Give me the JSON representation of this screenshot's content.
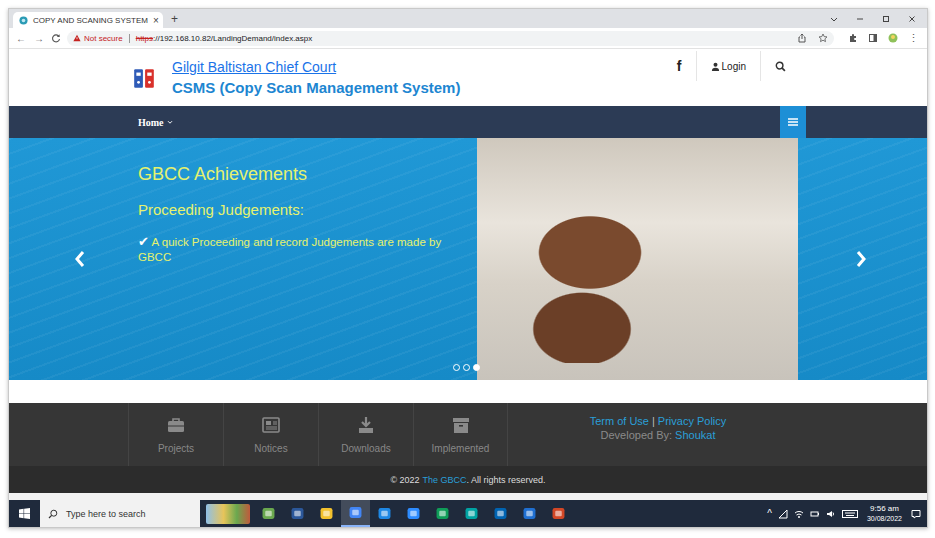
{
  "browser": {
    "tab": {
      "title": "COPY AND SCANING SYSTEM",
      "close": "×",
      "selected": true
    },
    "new_tab": "+",
    "back": "←",
    "forward": "→",
    "security": "Not secure",
    "url_scheme": "https",
    "url_rest": "://192.168.10.82/LandingDemand/index.aspx",
    "menu": "⋮"
  },
  "header": {
    "court": "Gilgit Baltistan Chief Court",
    "system": "CSMS (Copy Scan Management System)",
    "facebook": "f",
    "login": "Login"
  },
  "nav": {
    "items": [
      {
        "label": "Home",
        "selected": true
      }
    ]
  },
  "carousel": {
    "heading": "GBCC Achievements",
    "subheading": "Proceeding Judgements:",
    "check": "✔",
    "bullet": "A quick Proceeding and record Judgements are made by GBCC",
    "slides": [
      {
        "selected": false
      },
      {
        "selected": false
      },
      {
        "selected": true
      }
    ]
  },
  "footer": {
    "tiles": [
      {
        "label": "Projects"
      },
      {
        "label": "Notices"
      },
      {
        "label": "Downloads"
      },
      {
        "label": "Implemented"
      }
    ],
    "links": [
      "Term of Use",
      "Privacy Policy"
    ],
    "separator": "|",
    "developed_by": "Developed By:",
    "developer": "Shoukat",
    "copyright_prefix": "© 2022",
    "copyright_link": "The GBCC",
    "copyright_suffix": ". All rights reserved."
  },
  "taskbar": {
    "search_placeholder": "Type here to search",
    "apps": [
      {
        "selected": false
      },
      {
        "selected": false
      },
      {
        "selected": false
      },
      {
        "selected": true
      },
      {
        "selected": false
      },
      {
        "selected": false
      },
      {
        "selected": false
      },
      {
        "selected": false
      },
      {
        "selected": false
      },
      {
        "selected": false
      },
      {
        "selected": false
      }
    ],
    "tray_caret": "^",
    "time": "9:56 am",
    "date": "30/08/2022"
  }
}
